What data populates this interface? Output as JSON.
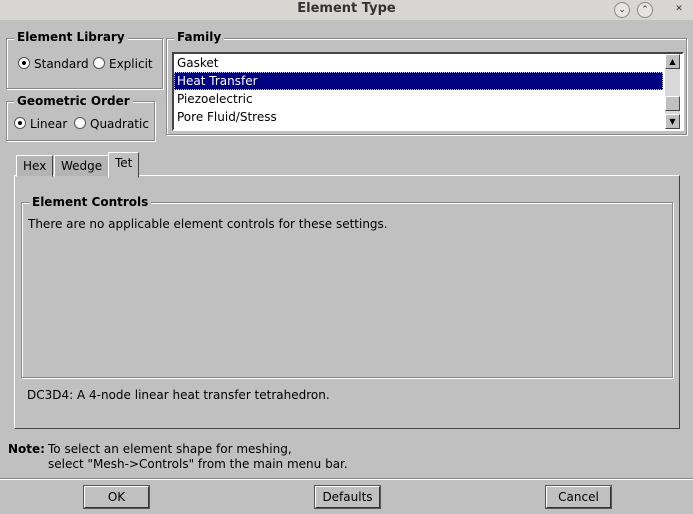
{
  "window": {
    "title": "Element Type",
    "minimize": "⌄",
    "maximize": "⌃",
    "close": "✕"
  },
  "element_library": {
    "label": "Element Library",
    "options": [
      "Standard",
      "Explicit"
    ],
    "selected": "Standard"
  },
  "geometric_order": {
    "label": "Geometric Order",
    "options": [
      "Linear",
      "Quadratic"
    ],
    "selected": "Linear"
  },
  "family": {
    "label": "Family",
    "items": [
      "Gasket",
      "Heat Transfer",
      "Piezoelectric",
      "Pore Fluid/Stress"
    ],
    "selected": "Heat Transfer"
  },
  "tabs": [
    "Hex",
    "Wedge",
    "Tet"
  ],
  "active_tab": "Tet",
  "controls": {
    "label": "Element Controls",
    "message": "There are no applicable element controls for these settings."
  },
  "element_description": "DC3D4:  A 4-node linear heat transfer tetrahedron.",
  "note": {
    "label": "Note:",
    "line1": "To select an element shape for meshing,",
    "line2": "select \"Mesh->Controls\" from the main menu bar."
  },
  "buttons": {
    "ok": "OK",
    "defaults": "Defaults",
    "cancel": "Cancel"
  }
}
